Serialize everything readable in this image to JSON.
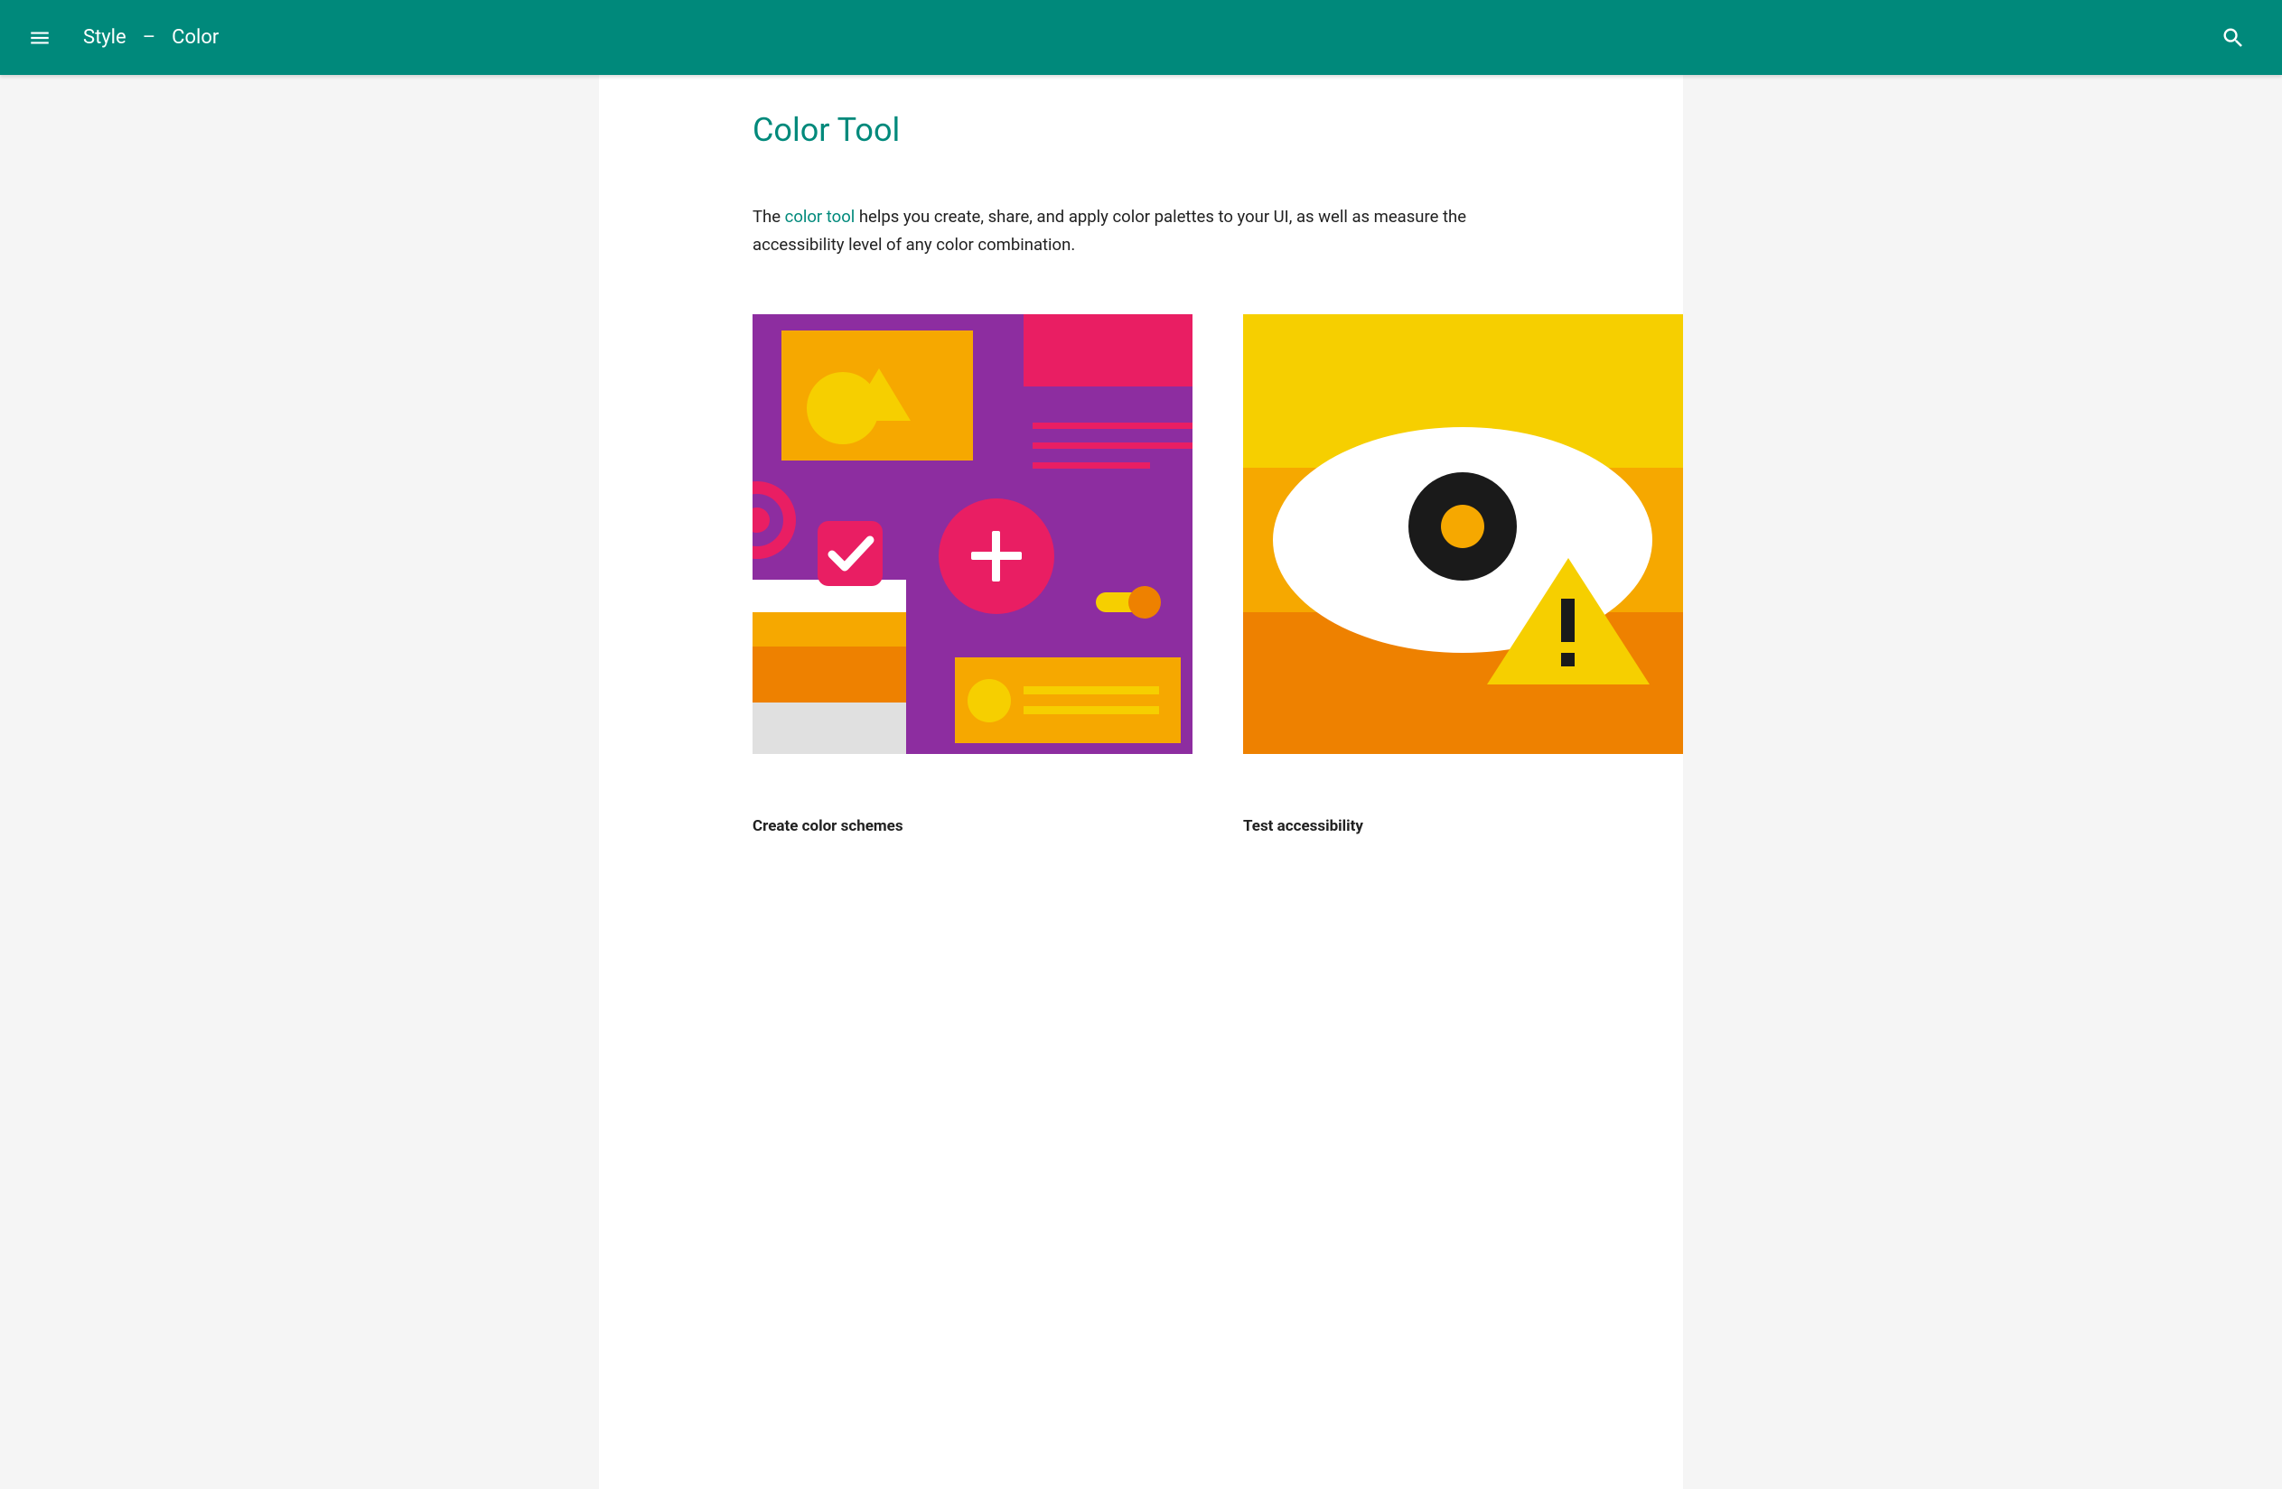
{
  "header": {
    "breadcrumb_section": "Style",
    "breadcrumb_separator": "–",
    "breadcrumb_page": "Color"
  },
  "page": {
    "title": "Color Tool",
    "intro_prefix": "The ",
    "intro_link": "color tool",
    "intro_suffix": " helps you create, share, and apply color palettes to your UI, as well as measure the accessibility level of any color combination."
  },
  "cards": [
    {
      "title": "Create color schemes"
    },
    {
      "title": "Test accessibility"
    }
  ]
}
